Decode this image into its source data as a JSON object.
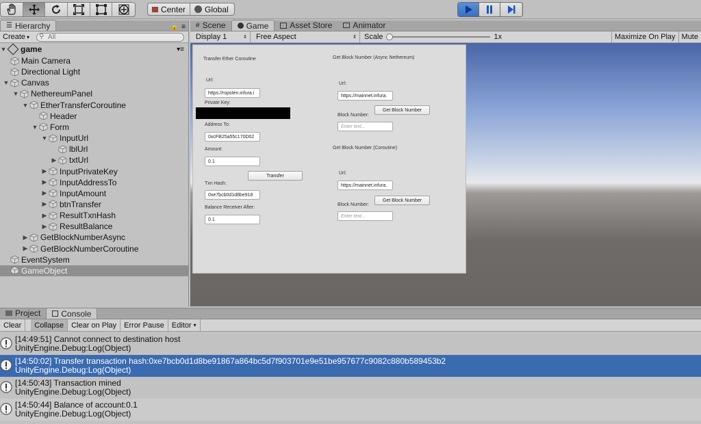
{
  "toolbar": {
    "tools": [
      "hand-tool-icon",
      "move-tool-icon",
      "rotate-tool-icon",
      "scale-tool-icon",
      "rect-tool-icon",
      "transform-tool-icon"
    ],
    "pivot_label": "Center",
    "space_label": "Global"
  },
  "hierarchy": {
    "tab_label": "Hierarchy",
    "create_label": "Create",
    "search_placeholder": "All",
    "scene_name": "game",
    "items": [
      {
        "label": "Main Camera",
        "depth": 1
      },
      {
        "label": "Directional Light",
        "depth": 1
      },
      {
        "label": "Canvas",
        "depth": 1,
        "expanded": true
      },
      {
        "label": "NethereumPanel",
        "depth": 2,
        "expanded": true
      },
      {
        "label": "EtherTransferCoroutine",
        "depth": 3,
        "expanded": true
      },
      {
        "label": "Header",
        "depth": 4
      },
      {
        "label": "Form",
        "depth": 4,
        "expanded": true
      },
      {
        "label": "InputUrl",
        "depth": 5,
        "expanded": true
      },
      {
        "label": "lblUrl",
        "depth": 6
      },
      {
        "label": "txtUrl",
        "depth": 6,
        "collapsed": true
      },
      {
        "label": "InputPrivateKey",
        "depth": 5,
        "collapsed": true
      },
      {
        "label": "InputAddressTo",
        "depth": 5,
        "collapsed": true
      },
      {
        "label": "InputAmount",
        "depth": 5,
        "collapsed": true
      },
      {
        "label": "btnTransfer",
        "depth": 5,
        "collapsed": true
      },
      {
        "label": "ResultTxnHash",
        "depth": 5,
        "collapsed": true
      },
      {
        "label": "ResultBalance",
        "depth": 5,
        "collapsed": true
      },
      {
        "label": "GetBlockNumberAsync",
        "depth": 3,
        "collapsed": true
      },
      {
        "label": "GetBlockNumberCoroutine",
        "depth": 3,
        "collapsed": true
      },
      {
        "label": "EventSystem",
        "depth": 1
      },
      {
        "label": "GameObject",
        "depth": 1,
        "selected": true
      }
    ]
  },
  "view_tabs": {
    "scene": "Scene",
    "game": "Game",
    "asset_store": "Asset Store",
    "animator": "Animator"
  },
  "game_toolbar": {
    "display": "Display 1",
    "aspect": "Free Aspect",
    "scale_label": "Scale",
    "scale_value": "1x",
    "maximize": "Maximize On Play",
    "mute": "Mute"
  },
  "game_ui": {
    "transfer_header": "Transfer Ether Coroutine",
    "url_label": "Url:",
    "url_value": "https://ropsten.infura.i",
    "private_key_label": "Private Key:",
    "address_label": "Address To:",
    "address_value": "0xcFB25a55c170D02",
    "amount_label": "Amount:",
    "amount_value": "0.1",
    "transfer_button": "Transfer",
    "txn_hash_label": "Txn Hash:",
    "txn_hash_value": "0xe7bcb0d1d8be918",
    "balance_label": "Balance Receiver After:",
    "balance_value": "0.1",
    "async_header": "Get Block Number (Async Nethereum)",
    "async_url_label": "Url:",
    "async_url_value": "https://mainnet.infura.",
    "async_block_label": "Block Number:",
    "async_button": "Get Block Number",
    "async_block_placeholder": "Enter text...",
    "coroutine_header": "Get Block Number (Coroutine)",
    "coroutine_url_label": "Url:",
    "coroutine_url_value": "https://mainnet.infura.",
    "coroutine_block_label": "Block Number:",
    "coroutine_button": "Get Block Number",
    "coroutine_block_placeholder": "Enter text..."
  },
  "console": {
    "project_tab": "Project",
    "console_tab": "Console",
    "buttons": {
      "clear": "Clear",
      "collapse": "Collapse",
      "clear_on_play": "Clear on Play",
      "error_pause": "Error Pause",
      "editor": "Editor"
    },
    "logs": [
      {
        "line1": "[14:49:51] Cannot connect to destination host",
        "line2": "UnityEngine.Debug:Log(Object)"
      },
      {
        "line1": "[14:50:02] Transfer transaction hash:0xe7bcb0d1d8be91867a864bc5d7f903701e9e51be957677c9082c880b589453b2",
        "line2": "UnityEngine.Debug:Log(Object)"
      },
      {
        "line1": "[14:50:43] Transaction mined",
        "line2": "UnityEngine.Debug:Log(Object)"
      },
      {
        "line1": "[14:50:44] Balance of account:0.1",
        "line2": "UnityEngine.Debug:Log(Object)"
      }
    ]
  }
}
